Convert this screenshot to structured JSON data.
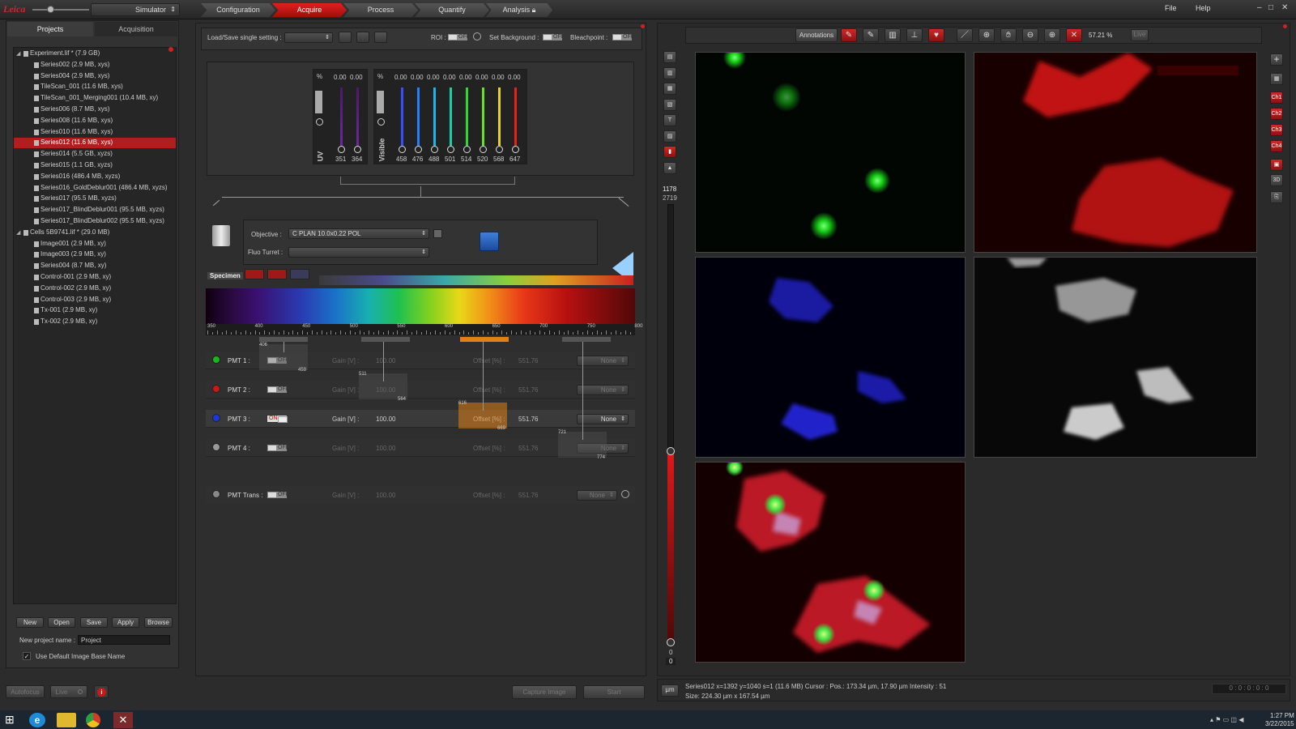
{
  "top": {
    "simulator": "Simulator",
    "workflow_tabs": [
      "Configuration",
      "Acquire",
      "Process",
      "Quantify",
      "Analysis"
    ],
    "menu": [
      "File",
      "Help"
    ]
  },
  "left": {
    "tabs": [
      "Projects",
      "Acquisition"
    ],
    "tree": [
      {
        "label": "Experiment.lif  *  (7.9 GB)",
        "level": 0,
        "expand": "◢"
      },
      {
        "label": "Series002  (2.9 MB, xys)",
        "level": 1
      },
      {
        "label": "Series004  (2.9 MB, xys)",
        "level": 1
      },
      {
        "label": "TileScan_001  (11.6 MB, xys)",
        "level": 1
      },
      {
        "label": "TileScan_001_Merging001  (10.4 MB, xy)",
        "level": 1
      },
      {
        "label": "Series006  (8.7 MB, xys)",
        "level": 1
      },
      {
        "label": "Series008  (11.6 MB, xys)",
        "level": 1
      },
      {
        "label": "Series010  (11.6 MB, xys)",
        "level": 1
      },
      {
        "label": "Series012  (11.6 MB, xys)",
        "level": 1,
        "selected": true
      },
      {
        "label": "Series014  (5.5 GB, xyzs)",
        "level": 1
      },
      {
        "label": "Series015  (1.1 GB, xyzs)",
        "level": 1
      },
      {
        "label": "Series016  (486.4 MB, xyzs)",
        "level": 1
      },
      {
        "label": "Series016_GoldDeblur001  (486.4 MB, xyzs)",
        "level": 1
      },
      {
        "label": "Series017  (95.5 MB, xyzs)",
        "level": 1
      },
      {
        "label": "Series017_BlindDeblur001  (95.5 MB, xyzs)",
        "level": 1
      },
      {
        "label": "Series017_BlindDeblur002  (95.5 MB, xyzs)",
        "level": 1
      },
      {
        "label": "Cells 5B9741.lif  *  (29.0 MB)",
        "level": 0,
        "expand": "◢"
      },
      {
        "label": "Image001  (2.9 MB, xy)",
        "level": 1
      },
      {
        "label": "Image003  (2.9 MB, xy)",
        "level": 1
      },
      {
        "label": "Series004  (8.7 MB, xy)",
        "level": 1
      },
      {
        "label": "Control-001  (2.9 MB, xy)",
        "level": 1
      },
      {
        "label": "Control-002  (2.9 MB, xy)",
        "level": 1
      },
      {
        "label": "Control-003  (2.9 MB, xy)",
        "level": 1
      },
      {
        "label": "Tx-001  (2.9 MB, xy)",
        "level": 1
      },
      {
        "label": "Tx-002  (2.9 MB, xy)",
        "level": 1
      }
    ],
    "buttons": [
      "New",
      "Open",
      "Save",
      "Apply",
      "Browse"
    ],
    "project_name_label": "New project name :",
    "project_name_value": "Project",
    "default_name_label": "Use Default Image Base Name",
    "autofocus": "Autofocus",
    "live": "Live"
  },
  "center": {
    "load_save": "Load/Save single setting :",
    "roi": "ROI :",
    "set_background": "Set Background :",
    "bleachpoint": "Bleachpoint :",
    "off": "OFF",
    "on": "ON",
    "pct": "%",
    "uv_label": "UV",
    "uv_values": [
      "0.00",
      "0.00"
    ],
    "uv_wavelengths": [
      "351",
      "364"
    ],
    "visible_label": "Visible",
    "vis_values": [
      "0.00",
      "0.00",
      "0.00",
      "0.00",
      "0.00",
      "0.00",
      "0.00",
      "0.00"
    ],
    "vis_wavelengths": [
      "458",
      "476",
      "488",
      "501",
      "514",
      "520",
      "568",
      "647"
    ],
    "vis_colors": [
      "#3a4cff",
      "#2a7cff",
      "#18b8e8",
      "#18d0a8",
      "#2ad838",
      "#6ae020",
      "#e8d020",
      "#e82020"
    ],
    "objective_label": "Objective :",
    "objective_value": "C PLAN  10.0x0.22 POL",
    "fluo_label": "Fluo Turret :",
    "specimen": "Specimen",
    "spectrum_ticks": [
      "350",
      "400",
      "450",
      "500",
      "550",
      "600",
      "650",
      "700",
      "750",
      "800"
    ],
    "pmts": [
      {
        "name": "PMT 1 :",
        "state": "OFF",
        "gain_label": "Gain [V] :",
        "gain": "100.00",
        "offset_label": "Offset [%] :",
        "offset": "551.76",
        "lut": "None",
        "color": "#18b818",
        "active": false,
        "range_lo": "406",
        "range_hi": "459"
      },
      {
        "name": "PMT 2 :",
        "state": "OFF",
        "gain_label": "Gain [V] :",
        "gain": "100.00",
        "offset_label": "Offset [%] :",
        "offset": "551.76",
        "lut": "None",
        "color": "#c81818",
        "active": false,
        "range_lo": "511",
        "range_hi": "564"
      },
      {
        "name": "PMT 3 :",
        "state": "ON",
        "gain_label": "Gain [V] :",
        "gain": "100.00",
        "offset_label": "Offset [%] :",
        "offset": "551.76",
        "lut": "None",
        "color": "#1838d8",
        "active": true,
        "range_lo": "616",
        "range_hi": "669"
      },
      {
        "name": "PMT 4 :",
        "state": "OFF",
        "gain_label": "Gain [V] :",
        "gain": "100.00",
        "offset_label": "Offset [%] :",
        "offset": "551.76",
        "lut": "None",
        "color": "#9a9a9a",
        "active": false,
        "range_lo": "721",
        "range_hi": "774"
      }
    ],
    "pmt_trans": {
      "name": "PMT Trans :",
      "state": "OFF",
      "gain_label": "Gain [V] :",
      "gain": "100.00",
      "offset_label": "Offset [%] :",
      "offset": "551.76",
      "lut": "None"
    },
    "capture": "Capture Image",
    "start": "Start"
  },
  "viewer": {
    "annotations": "Annotations",
    "zoom": "57.21 %",
    "live": "Live",
    "scale_top": "1178",
    "scale_top2": "2719",
    "scale_bottom": "0",
    "scale_bottom2": "0",
    "channels": [
      "Ch1",
      "Ch2",
      "Ch3",
      "Ch4"
    ],
    "three_d": "3D",
    "unit": "µm",
    "status_line1": "Series012  x=1392  y=1040  s=1  (11.6 MB)      Cursor :  Pos.: 173.34 µm, 17.90 µm      Intensity : 51",
    "status_line2": "Size: 224.30 µm x 167.54 µm",
    "timer": "0 : 0 : 0 : 0 : 0"
  },
  "taskbar": {
    "time": "1:27 PM",
    "date": "3/22/2015"
  }
}
